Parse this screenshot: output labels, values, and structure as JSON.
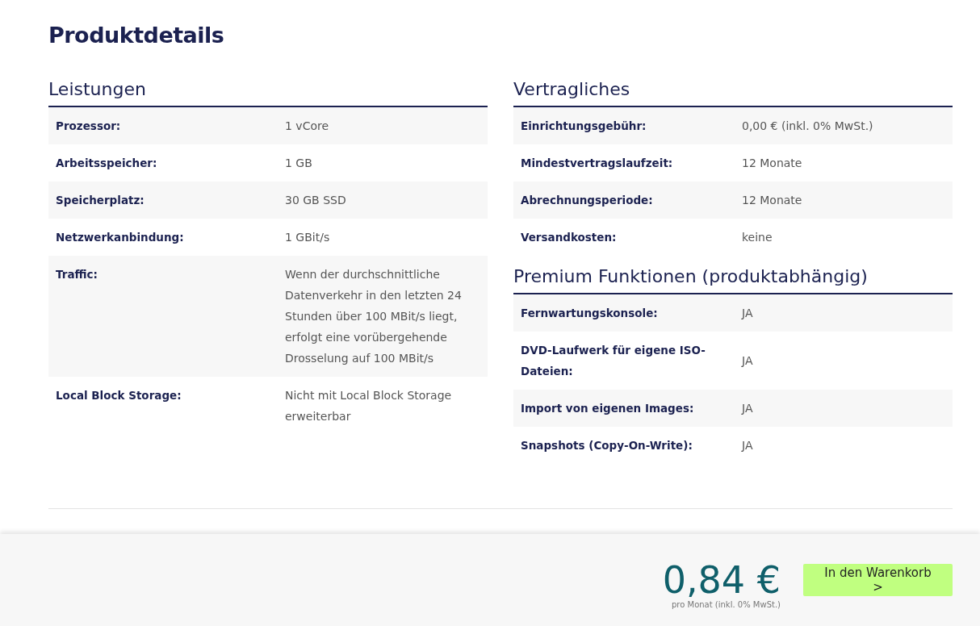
{
  "title": "Produktdetails",
  "columns": [
    [
      {
        "heading": "Leistungen",
        "rows": [
          {
            "label": "Prozessor:",
            "value": "1 vCore"
          },
          {
            "label": "Arbeitsspeicher:",
            "value": "1 GB"
          },
          {
            "label": "Speicherplatz:",
            "value": "30 GB SSD"
          },
          {
            "label": "Netzwerkanbindung:",
            "value": "1 GBit/s"
          },
          {
            "label": "Traffic:",
            "value": "Wenn der durchschnittliche Datenverkehr in den letzten 24 Stunden über 100 MBit/s liegt, erfolgt eine vorübergehende Drosselung auf 100 MBit/s"
          },
          {
            "label": "Local Block Storage:",
            "value": "Nicht mit Local Block Storage erweiterbar"
          }
        ]
      }
    ],
    [
      {
        "heading": "Vertragliches",
        "rows": [
          {
            "label": "Einrichtungsgebühr:",
            "value": "0,00 € (inkl. 0% MwSt.)"
          },
          {
            "label": "Mindestvertragslaufzeit:",
            "value": "12 Monate"
          },
          {
            "label": "Abrechnungsperiode:",
            "value": "12 Monate"
          },
          {
            "label": "Versandkosten:",
            "value": "keine"
          }
        ]
      },
      {
        "heading": "Premium Funktionen (produktabhängig)",
        "rows": [
          {
            "label": "Fernwartungskonsole:",
            "value": "JA"
          },
          {
            "label": "DVD-Laufwerk für eigene ISO-Dateien:",
            "value": "JA"
          },
          {
            "label": "Import von eigenen Images:",
            "value": "JA"
          },
          {
            "label": "Snapshots (Copy-On-Write):",
            "value": "JA"
          }
        ]
      }
    ]
  ],
  "footer": {
    "price": "0,84 €",
    "price_note": "pro Monat (inkl. 0% MwSt.)",
    "button": "In den Warenkorb >"
  }
}
